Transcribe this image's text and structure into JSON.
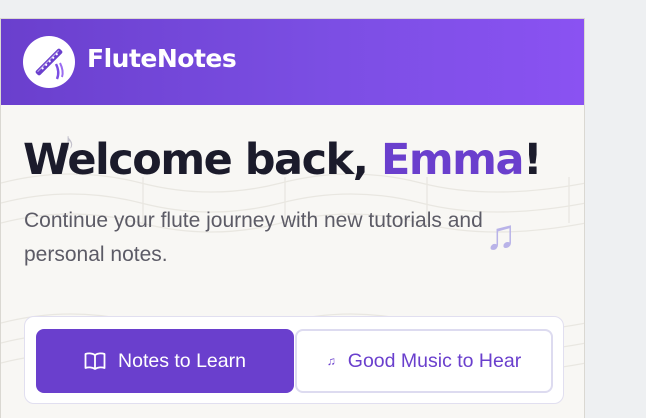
{
  "app": {
    "title": "FluteNotes",
    "logo_icon": "flute-icon"
  },
  "hero": {
    "greeting": "Welcome back,",
    "user_name": "Emma",
    "exclamation": "!",
    "subtitle": "Continue your flute journey with new tutorials and personal notes."
  },
  "tabs": [
    {
      "label": "Notes to Learn",
      "icon": "book-open-icon",
      "active": true
    },
    {
      "label": "Good Music to Hear",
      "icon": "music-note-icon",
      "active": false
    }
  ],
  "decorations": {
    "note_small": "♪",
    "note_large": "♫"
  },
  "colors": {
    "brand": "#6a3fcd",
    "header_gradient_end": "#8a52f2",
    "heading_text": "#1b1b2b",
    "body_text": "#5c5b66",
    "panel_bg": "#f8f7f4"
  }
}
